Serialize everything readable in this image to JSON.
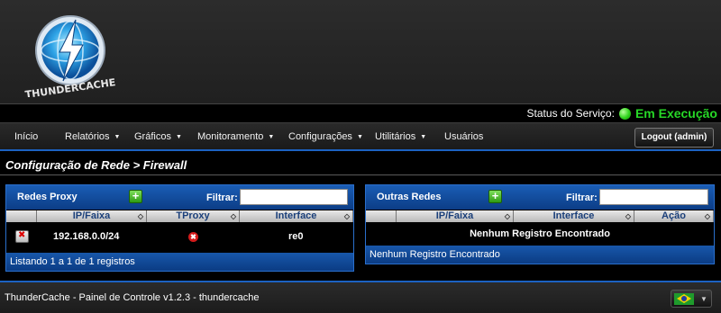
{
  "logo": {
    "text": "THUNDERCACHE"
  },
  "status": {
    "label": "Status do Serviço:",
    "value": "Em Execução",
    "color": "#27d827"
  },
  "nav": {
    "items": [
      {
        "label": "Início",
        "caret": ""
      },
      {
        "label": "Relatórios",
        "caret": "▼"
      },
      {
        "label": "Gráficos",
        "caret": "▼"
      },
      {
        "label": "Monitoramento",
        "caret": "▼"
      },
      {
        "label": "Configurações",
        "caret": "▼"
      },
      {
        "label": "Utilitários",
        "caret": "▼"
      },
      {
        "label": "Usuários",
        "caret": ""
      }
    ],
    "logout_label": "Logout (admin)"
  },
  "breadcrumb": "Configuração de Rede > Firewall",
  "proxy_panel": {
    "title": "Redes Proxy",
    "add_label": "+",
    "filter_label": "Filtrar:",
    "filter_value": "",
    "columns": [
      "IP/Faixa",
      "TProxy",
      "Interface"
    ],
    "rows": [
      {
        "ip": "192.168.0.0/24",
        "tproxy": "✖",
        "interface": "re0"
      }
    ],
    "footer": "Listando 1 a 1 de 1 registros"
  },
  "other_panel": {
    "title": "Outras Redes",
    "add_label": "+",
    "filter_label": "Filtrar:",
    "filter_value": "",
    "columns": [
      "IP/Faixa",
      "Interface",
      "Ação"
    ],
    "empty_message": "Nenhum Registro Encontrado",
    "footer": "Nenhum Registro Encontrado"
  },
  "footer": {
    "text": "ThunderCache - Painel de Controle v1.2.3 - thundercache",
    "language": "pt-BR"
  },
  "colors": {
    "accent": "#1c62c2",
    "panel_head": "#1a5db5",
    "status_green": "#27d827"
  }
}
